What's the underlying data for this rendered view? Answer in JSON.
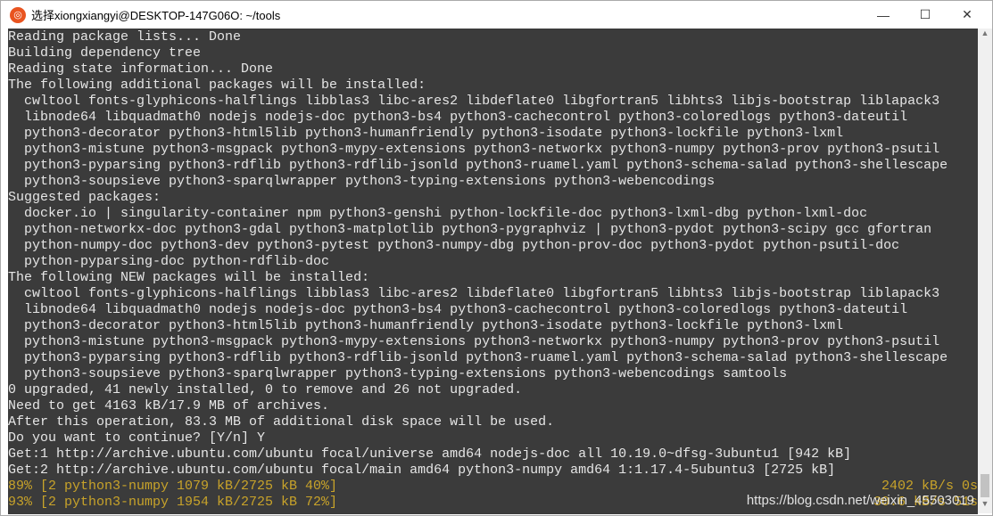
{
  "window": {
    "title": "选择xiongxiangyi@DESKTOP-147G06O: ~/tools",
    "icon": "ubuntu-icon"
  },
  "lines": [
    "Reading package lists... Done",
    "Building dependency tree",
    "Reading state information... Done",
    "The following additional packages will be installed:",
    "  cwltool fonts-glyphicons-halflings libblas3 libc-ares2 libdeflate0 libgfortran5 libhts3 libjs-bootstrap liblapack3",
    "  libnode64 libquadmath0 nodejs nodejs-doc python3-bs4 python3-cachecontrol python3-coloredlogs python3-dateutil",
    "  python3-decorator python3-html5lib python3-humanfriendly python3-isodate python3-lockfile python3-lxml",
    "  python3-mistune python3-msgpack python3-mypy-extensions python3-networkx python3-numpy python3-prov python3-psutil",
    "  python3-pyparsing python3-rdflib python3-rdflib-jsonld python3-ruamel.yaml python3-schema-salad python3-shellescape",
    "  python3-soupsieve python3-sparqlwrapper python3-typing-extensions python3-webencodings",
    "Suggested packages:",
    "  docker.io | singularity-container npm python3-genshi python-lockfile-doc python3-lxml-dbg python-lxml-doc",
    "  python-networkx-doc python3-gdal python3-matplotlib python3-pygraphviz | python3-pydot python3-scipy gcc gfortran",
    "  python-numpy-doc python3-dev python3-pytest python3-numpy-dbg python-prov-doc python3-pydot python-psutil-doc",
    "  python-pyparsing-doc python-rdflib-doc",
    "The following NEW packages will be installed:",
    "  cwltool fonts-glyphicons-halflings libblas3 libc-ares2 libdeflate0 libgfortran5 libhts3 libjs-bootstrap liblapack3",
    "  libnode64 libquadmath0 nodejs nodejs-doc python3-bs4 python3-cachecontrol python3-coloredlogs python3-dateutil",
    "  python3-decorator python3-html5lib python3-humanfriendly python3-isodate python3-lockfile python3-lxml",
    "  python3-mistune python3-msgpack python3-mypy-extensions python3-networkx python3-numpy python3-prov python3-psutil",
    "  python3-pyparsing python3-rdflib python3-rdflib-jsonld python3-ruamel.yaml python3-schema-salad python3-shellescape",
    "  python3-soupsieve python3-sparqlwrapper python3-typing-extensions python3-webencodings samtools",
    "0 upgraded, 41 newly installed, 0 to remove and 26 not upgraded.",
    "Need to get 4163 kB/17.9 MB of archives.",
    "After this operation, 83.3 MB of additional disk space will be used.",
    "Do you want to continue? [Y/n] Y",
    "Get:1 http://archive.ubuntu.com/ubuntu focal/universe amd64 nodejs-doc all 10.19.0~dfsg-3ubuntu1 [942 kB]",
    "Get:2 http://archive.ubuntu.com/ubuntu focal/main amd64 python3-numpy amd64 1:1.17.4-5ubuntu3 [2725 kB]"
  ],
  "progress": [
    {
      "left": "89% [2 python3-numpy 1079 kB/2725 kB 40%]",
      "right": "2402 kB/s 0s",
      "percent": 40
    },
    {
      "left": "93% [2 python3-numpy 1954 kB/2725 kB 72%]",
      "right": "30.6 kB/s 51s",
      "percent": 72
    }
  ],
  "watermark": "https://blog.csdn.net/weixin_45503019",
  "controls": {
    "minimize": "—",
    "maximize": "☐",
    "close": "✕"
  }
}
